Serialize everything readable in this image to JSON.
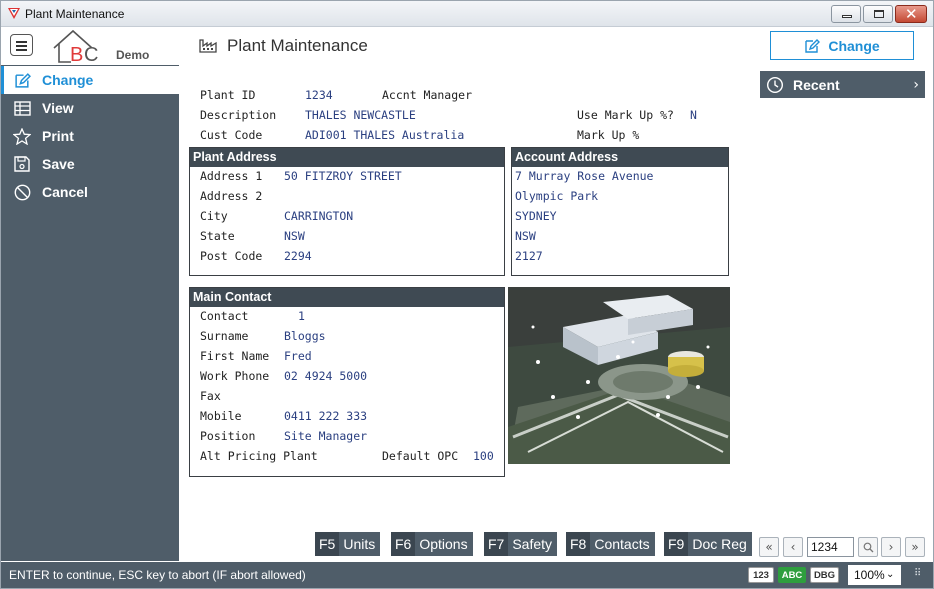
{
  "window": {
    "title": "Plant Maintenance"
  },
  "header": {
    "logo_demo": "Demo",
    "page_title": "Plant Maintenance",
    "change_button": "Change"
  },
  "sidebar": {
    "items": [
      {
        "label": "Change",
        "icon": "edit-icon"
      },
      {
        "label": "View",
        "icon": "table-icon"
      },
      {
        "label": "Print",
        "icon": "star-icon"
      },
      {
        "label": "Save",
        "icon": "save-icon"
      },
      {
        "label": "Cancel",
        "icon": "cancel-icon"
      }
    ]
  },
  "recent": {
    "label": "Recent"
  },
  "plant": {
    "plant_id_label": "Plant ID",
    "plant_id": "1234",
    "accnt_manager_label": "Accnt Manager",
    "description_label": "Description",
    "description": "THALES NEWCASTLE",
    "use_markup_label": "Use Mark Up %?",
    "use_markup": "N",
    "cust_code_label": "Cust Code",
    "cust_code": "ADI001 THALES Australia",
    "markup_label": "Mark Up %"
  },
  "plant_address": {
    "title": "Plant Address",
    "address1_label": "Address 1",
    "address1": "50 FITZROY STREET",
    "address2_label": "Address 2",
    "city_label": "City",
    "city": "CARRINGTON",
    "state_label": "State",
    "state": "NSW",
    "postcode_label": "Post Code",
    "postcode": "2294"
  },
  "account_address": {
    "title": "Account Address",
    "lines": [
      "7 Murray Rose Avenue",
      "Olympic Park",
      "SYDNEY",
      "NSW",
      "2127"
    ]
  },
  "main_contact": {
    "title": "Main Contact",
    "contact_label": "Contact",
    "contact": "1",
    "surname_label": "Surname",
    "surname": "Bloggs",
    "first_name_label": "First Name",
    "first_name": "Fred",
    "work_phone_label": "Work Phone",
    "work_phone": "02 4924 5000",
    "fax_label": "Fax",
    "mobile_label": "Mobile",
    "mobile": "0411 222 333",
    "position_label": "Position",
    "position": "Site Manager",
    "alt_pricing_label": "Alt Pricing Plant",
    "default_opc_label": "Default OPC",
    "default_opc": "100"
  },
  "function_keys": [
    {
      "key": "F5",
      "label": "Units"
    },
    {
      "key": "F6",
      "label": "Options"
    },
    {
      "key": "F7",
      "label": "Safety"
    },
    {
      "key": "F8",
      "label": "Contacts"
    },
    {
      "key": "F9",
      "label": "Doc Reg"
    }
  ],
  "navigator": {
    "value": "1234"
  },
  "status": {
    "message": "ENTER to continue, ESC key to abort (IF abort allowed)",
    "badge_123": "123",
    "badge_abc": "ABC",
    "badge_dbg": "DBG",
    "zoom": "100%"
  },
  "colors": {
    "accent": "#1f8fd6",
    "sidebar": "#4f5d69",
    "panel_header": "#3f4a53",
    "value_text": "#2a3f80"
  }
}
